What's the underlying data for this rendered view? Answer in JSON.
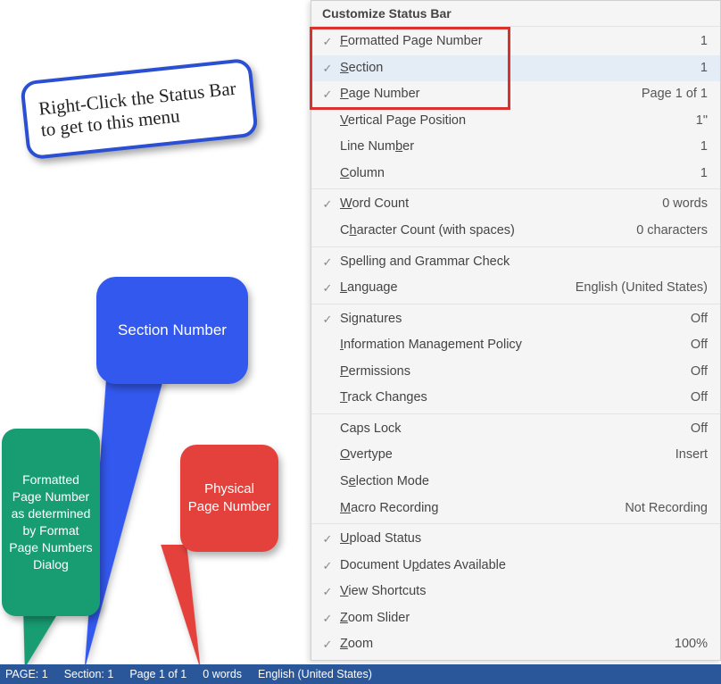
{
  "menu": {
    "title": "Customize Status Bar",
    "groups": [
      [
        {
          "checked": true,
          "label_pre": "",
          "u": "F",
          "label_post": "ormatted Page Number",
          "value": "1",
          "hl": false
        },
        {
          "checked": true,
          "label_pre": "",
          "u": "S",
          "label_post": "ection",
          "value": "1",
          "hl": true
        },
        {
          "checked": true,
          "label_pre": "",
          "u": "P",
          "label_post": "age Number",
          "value": "Page 1 of 1",
          "hl": false
        },
        {
          "checked": false,
          "label_pre": "",
          "u": "V",
          "label_post": "ertical Page Position",
          "value": "1\"",
          "hl": false
        },
        {
          "checked": false,
          "label_pre": "Line Num",
          "u": "b",
          "label_post": "er",
          "value": "1",
          "hl": false
        },
        {
          "checked": false,
          "label_pre": "",
          "u": "C",
          "label_post": "olumn",
          "value": "1",
          "hl": false
        }
      ],
      [
        {
          "checked": true,
          "label_pre": "",
          "u": "W",
          "label_post": "ord Count",
          "value": "0 words",
          "hl": false
        },
        {
          "checked": false,
          "label_pre": "C",
          "u": "h",
          "label_post": "aracter Count (with spaces)",
          "value": "0 characters",
          "hl": false
        }
      ],
      [
        {
          "checked": true,
          "label_pre": "Spelling and Grammar Check",
          "u": "",
          "label_post": "",
          "value": "",
          "hl": false
        },
        {
          "checked": true,
          "label_pre": "",
          "u": "L",
          "label_post": "anguage",
          "value": "English (United States)",
          "hl": false
        }
      ],
      [
        {
          "checked": true,
          "label_pre": "Si",
          "u": "g",
          "label_post": "natures",
          "value": "Off",
          "hl": false
        },
        {
          "checked": false,
          "label_pre": "",
          "u": "I",
          "label_post": "nformation Management Policy",
          "value": "Off",
          "hl": false
        },
        {
          "checked": false,
          "label_pre": "",
          "u": "P",
          "label_post": "ermissions",
          "value": "Off",
          "hl": false
        },
        {
          "checked": false,
          "label_pre": "",
          "u": "T",
          "label_post": "rack Changes",
          "value": "Off",
          "hl": false
        }
      ],
      [
        {
          "checked": false,
          "label_pre": "Caps Lock",
          "u": "",
          "label_post": "",
          "value": "Off",
          "hl": false
        },
        {
          "checked": false,
          "label_pre": "",
          "u": "O",
          "label_post": "vertype",
          "value": "Insert",
          "hl": false
        },
        {
          "checked": false,
          "label_pre": "S",
          "u": "e",
          "label_post": "lection Mode",
          "value": "",
          "hl": false
        },
        {
          "checked": false,
          "label_pre": "",
          "u": "M",
          "label_post": "acro Recording",
          "value": "Not Recording",
          "hl": false
        }
      ],
      [
        {
          "checked": true,
          "label_pre": "",
          "u": "U",
          "label_post": "pload Status",
          "value": "",
          "hl": false
        },
        {
          "checked": true,
          "label_pre": "Document U",
          "u": "p",
          "label_post": "dates Available",
          "value": "",
          "hl": false
        },
        {
          "checked": true,
          "label_pre": "",
          "u": "V",
          "label_post": "iew Shortcuts",
          "value": "",
          "hl": false
        },
        {
          "checked": true,
          "label_pre": "",
          "u": "Z",
          "label_post": "oom Slider",
          "value": "",
          "hl": false
        },
        {
          "checked": true,
          "label_pre": "",
          "u": "Z",
          "label_post": "oom",
          "value": "100%",
          "hl": false
        }
      ]
    ]
  },
  "highlight_box": {
    "top_item_index": 0,
    "item_count": 3
  },
  "status_bar": {
    "page": "PAGE: 1",
    "section": "Section: 1",
    "page_of": "Page 1 of 1",
    "words": "0 words",
    "language": "English (United States)"
  },
  "callouts": {
    "instruction": "Right-Click the Status Bar to get to this menu",
    "green": "Formatted Page Number as determined by Format Page Numbers Dialog",
    "blue": "Section Number",
    "red": "Physical Page Number"
  }
}
